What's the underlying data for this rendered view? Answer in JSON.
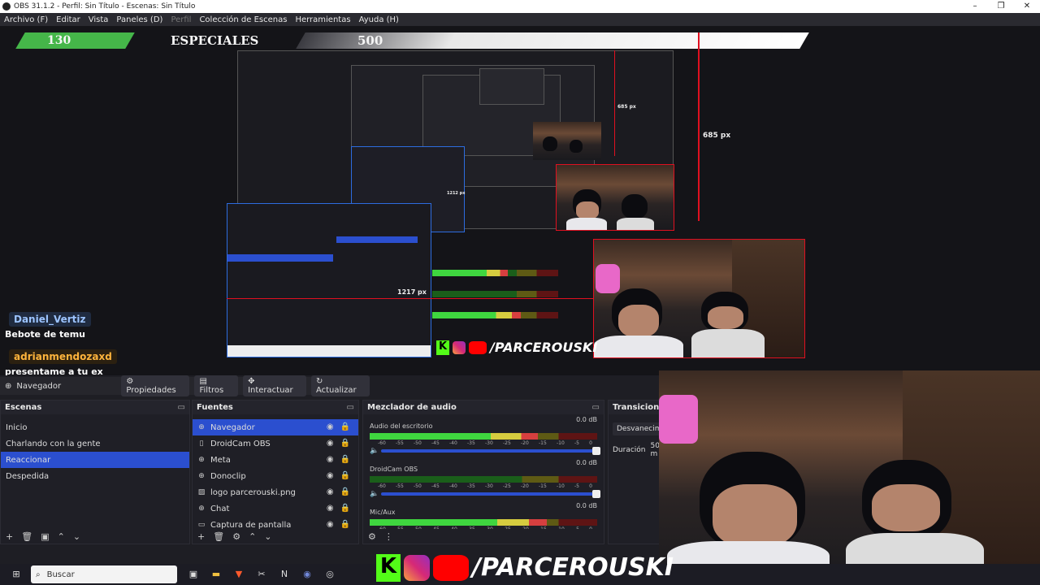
{
  "window": {
    "title": "OBS 31.1.2 - Perfil: Sin Título - Escenas: Sin Título",
    "controls": [
      "–",
      "❐",
      "✕"
    ]
  },
  "menu": [
    "Archivo (F)",
    "Editar",
    "Vista",
    "Paneles (D)",
    "Perfil",
    "Colección de Escenas",
    "Herramientas",
    "Ayuda (H)"
  ],
  "preview": {
    "score_left": "130",
    "category": "ESPECIALES",
    "score_right": "500",
    "measure_a": "685 px",
    "measure_b": "685 px",
    "measure_c": "1217 px",
    "measure_d": "1212 px"
  },
  "chat": {
    "user1": "Daniel_Vertiz",
    "msg1": "Bebote de temu",
    "user2": "adrianmendozaxd",
    "msg2": "presentame a tu ex"
  },
  "social": {
    "handle": "/PARCEROUSKI",
    "k": "K"
  },
  "toolbar": {
    "source": "Navegador",
    "properties": "Propiedades",
    "filters": "Filtros",
    "interact": "Interactuar",
    "refresh": "Actualizar"
  },
  "scenes": {
    "title": "Escenas",
    "items": [
      "Inicio",
      "Charlando con la gente",
      "Reaccionar",
      "Despedida"
    ],
    "selected": 2
  },
  "sources": {
    "title": "Fuentes",
    "items": [
      "Navegador",
      "DroidCam OBS",
      "Meta",
      "Donoclip",
      "logo parcerouski.png",
      "Chat",
      "Captura de pantalla"
    ]
  },
  "mixer": {
    "title": "Mezclador de audio",
    "channels": [
      {
        "name": "Audio del escritorio",
        "db": "0.0 dB",
        "level": 0.74
      },
      {
        "name": "DroidCam OBS",
        "db": "0.0 dB",
        "level": 0.0
      },
      {
        "name": "Mic/Aux",
        "db": "0.0 dB",
        "level": 0.78
      }
    ],
    "ticks": [
      "-60",
      "-55",
      "-50",
      "-45",
      "-40",
      "-35",
      "-30",
      "-25",
      "-20",
      "-15",
      "-10",
      "-5",
      "0"
    ]
  },
  "transitions": {
    "title": "Transiciones",
    "type": "Desvanecimie",
    "duration_label": "Duración",
    "duration_value": "50 m"
  },
  "taskbar": {
    "search": "Buscar"
  }
}
